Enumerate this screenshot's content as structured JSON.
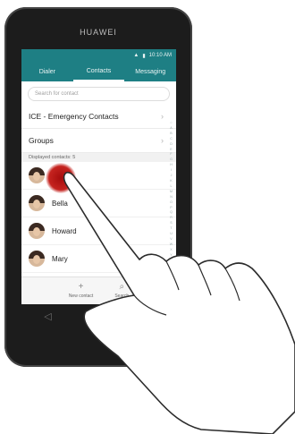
{
  "device": {
    "brand": "HUAWEI"
  },
  "status": {
    "time": "10:10 AM"
  },
  "tabs": [
    {
      "label": "Dialer"
    },
    {
      "label": "Contacts"
    },
    {
      "label": "Messaging"
    }
  ],
  "search": {
    "placeholder": "Search for contact"
  },
  "menu": {
    "ice": "ICE - Emergency Contacts",
    "groups": "Groups"
  },
  "displayed": "Displayed contacts: 5",
  "contacts": [
    {
      "name": ""
    },
    {
      "name": "Bella"
    },
    {
      "name": "Howard"
    },
    {
      "name": "Mary"
    }
  ],
  "bottom": {
    "new_contact": "New contact",
    "search": "Search"
  },
  "alphabet": [
    "☆",
    "A",
    "B",
    "C",
    "D",
    "E",
    "F",
    "G",
    "H",
    "I",
    "J",
    "K",
    "L",
    "M",
    "N",
    "O",
    "P",
    "Q",
    "R",
    "S",
    "T",
    "U",
    "V",
    "W",
    "X",
    "Y",
    "Z",
    "#"
  ],
  "colors": {
    "accent": "#1e7f84",
    "touch": "#c5231f"
  }
}
